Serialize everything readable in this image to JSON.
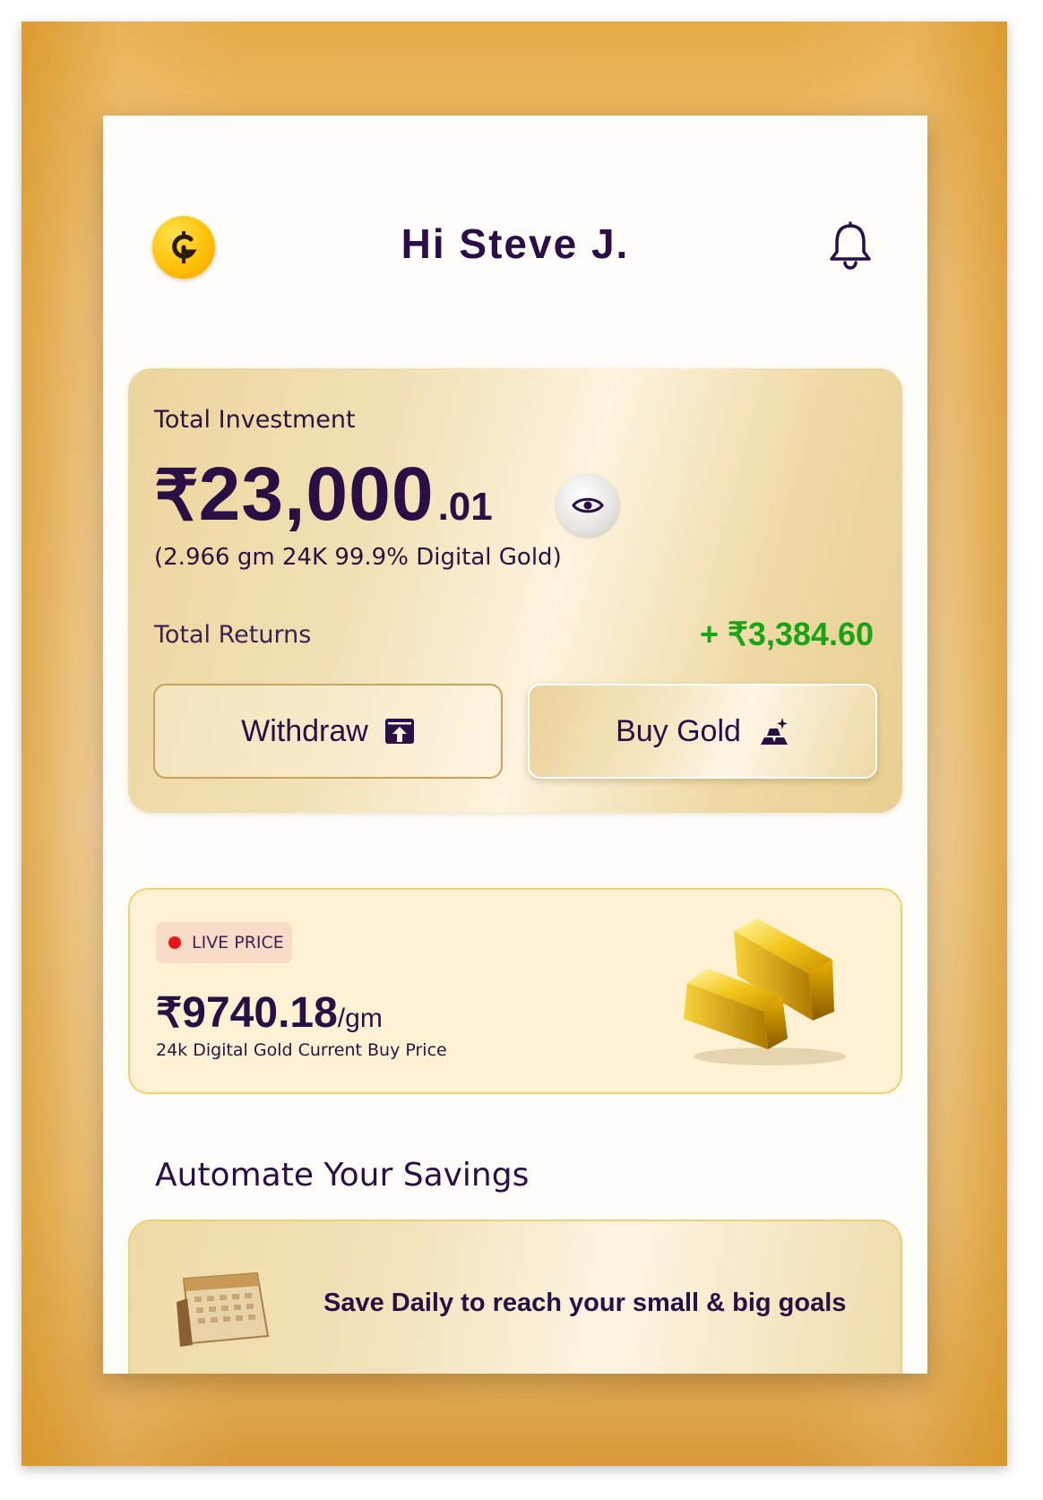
{
  "header": {
    "greeting": "Hi Steve J.",
    "logo_icon": "gold-coin-logo-icon",
    "bell_icon": "bell-icon"
  },
  "investment": {
    "label": "Total Investment",
    "currency_symbol": "₹",
    "amount_main": "23,000",
    "amount_decimal": ".01",
    "holding": "(2.966 gm 24K 99.9% Digital Gold)",
    "returns_label": "Total Returns",
    "returns_value": "+ ₹3,384.60",
    "withdraw_label": "Withdraw",
    "buy_label": "Buy Gold"
  },
  "live_price": {
    "badge": "LIVE PRICE",
    "currency_symbol": "₹",
    "value": "9740.18",
    "unit": "/gm",
    "subtitle": "24k Digital Gold Current Buy Price"
  },
  "automate": {
    "title": "Automate Your Savings",
    "card_text": "Save Daily to reach your small & big goals"
  },
  "colors": {
    "primary_text": "#2a0f45",
    "returns_green": "#1aa314",
    "live_red": "#e8141a",
    "gold_accent": "#f5cf6b"
  }
}
